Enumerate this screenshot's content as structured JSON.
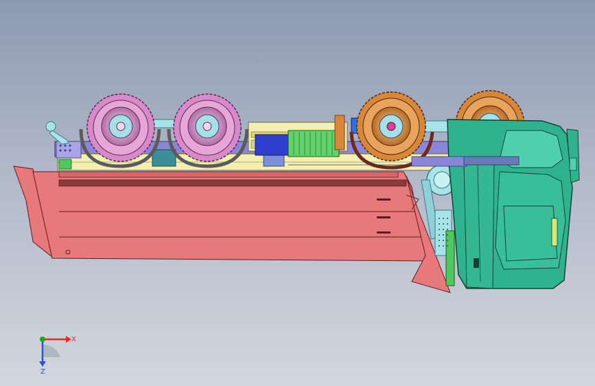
{
  "viewport": {
    "background_top": "#8c99b1",
    "background_bottom": "#d2d6dd"
  },
  "colors": {
    "dump_body": "#e8797a",
    "dump_body_dark": "#7a2a2d",
    "chassis_yellow": "#f3efb2",
    "chassis_purple": "#8c86d8",
    "rear_tire_pink": "#d889c9",
    "front_tire_orange": "#d8873a",
    "cab_green": "#2fb38f",
    "cab_green_light": "#4fd1ad",
    "pipe_cyan": "#a9e3ea",
    "tank_blue": "#2f3fd0",
    "mesh_green": "#62d36a",
    "triad_x": "#e32b2b",
    "triad_y": "#1fa81f",
    "triad_z": "#2f4fd8"
  },
  "triad": {
    "x_label": "X",
    "z_label": "Z"
  }
}
